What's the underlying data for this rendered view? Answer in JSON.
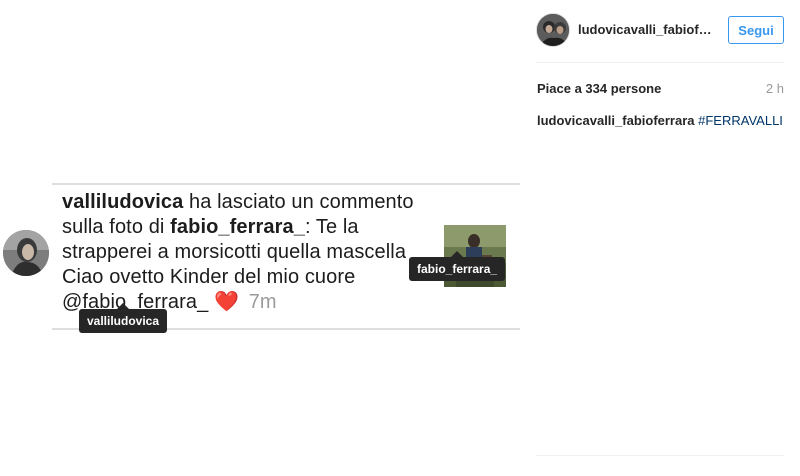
{
  "post": {
    "screenshot": {
      "line1_user": "vallilud​ovica",
      "line1_rest": " ha lasciato un commento",
      "line2_start": "sulla foto di ",
      "line2_user": "fabio_ferrara_",
      "line2_rest": ": Te la",
      "line3": "strapperei a morsicotti quella mascella",
      "line4": "Ciao ovetto Kinder del mio cuore",
      "line5_mention": "@fabio_ferrara_",
      "heart": "❤️",
      "time": "7m"
    },
    "tags": {
      "fabio": "fabio_ferrara_",
      "valli": "valliludovica"
    }
  },
  "panel": {
    "username": "ludovicavalli_fabioferrara",
    "follow_label": "Segui",
    "likes": "Piace a 334 persone",
    "time_ago": "2 h",
    "caption_user": "ludovicavalli_fabioferrara",
    "caption_hashtag": "#FERRAVALLI"
  },
  "colors": {
    "accent": "#3897f0",
    "hashtag": "#003569",
    "heart": "#e53935"
  },
  "icons": [
    "profile-avatar-icon",
    "heart-icon"
  ]
}
